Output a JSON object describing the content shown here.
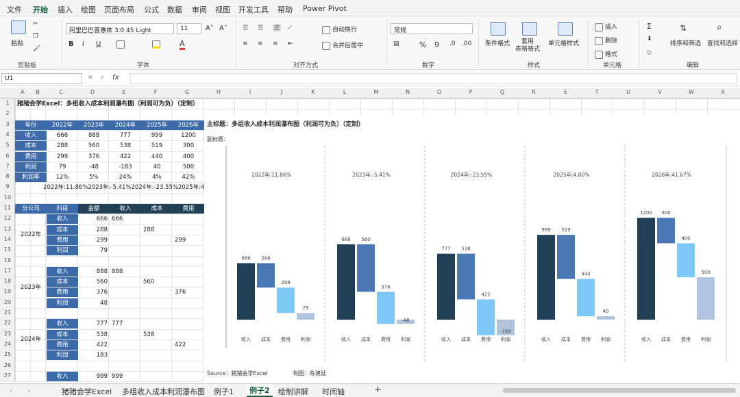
{
  "menu_tabs": [
    "文件",
    "开始",
    "插入",
    "绘图",
    "页面布局",
    "公式",
    "数据",
    "审阅",
    "视图",
    "开发工具",
    "帮助",
    "Power Pivot"
  ],
  "active_tab": "开始",
  "ribbon": {
    "paste": "粘贴",
    "clipboard_group": "剪贴板",
    "font_name": "阿里巴巴普惠体 3.0 45 Light",
    "font_size": "11",
    "font_group": "字体",
    "wrap_text": "自动换行",
    "merge_center": "合并后居中",
    "align_group": "对齐方式",
    "number_format": "常规",
    "number_group": "数字",
    "cond_format": "条件格式",
    "table_format": "套用\n表格格式",
    "cell_style": "单元格样式",
    "style_group": "样式",
    "insert": "插入",
    "delete": "删除",
    "format": "格式",
    "cells_group": "单元格",
    "sort_filter": "排序和筛选",
    "find_select": "查找和选择",
    "edit_group": "编辑"
  },
  "formula_bar": {
    "name_box": "U1",
    "fx": "fx",
    "formula": ""
  },
  "columns": [
    "A",
    "B",
    "C",
    "D",
    "E",
    "F",
    "G",
    "H",
    "I",
    "J",
    "K",
    "L",
    "M",
    "N",
    "O",
    "P",
    "Q",
    "R",
    "S",
    "T",
    "U",
    "V",
    "W",
    "X"
  ],
  "rows": [
    "1",
    "2",
    "3",
    "4",
    "5",
    "6",
    "7",
    "8",
    "9",
    "10",
    "11",
    "12",
    "13",
    "14",
    "15",
    "16",
    "17",
    "18",
    "19",
    "20",
    "21",
    "22",
    "23",
    "24",
    "25",
    "26",
    "27"
  ],
  "sheet_title": "猪猪会学Excel：多组收入成本利润瀑布图（利润可为负）（定制）",
  "table1": {
    "headers": [
      "年份",
      "2022年",
      "2023年",
      "2024年",
      "2025年",
      "2026年"
    ],
    "rows": [
      [
        "收入",
        "666",
        "888",
        "777",
        "999",
        "1200"
      ],
      [
        "成本",
        "288",
        "560",
        "538",
        "519",
        "300"
      ],
      [
        "费用",
        "299",
        "376",
        "422",
        "440",
        "400"
      ],
      [
        "利润",
        "79",
        "-48",
        "-183",
        "40",
        "500"
      ],
      [
        "利润率",
        "12%",
        "5%",
        "24%",
        "4%",
        "42%"
      ]
    ],
    "row9": "2022年:11.86%2023年:-5.41%2024年:-23.55%2025年:4.00%2026年:41.67"
  },
  "table2": {
    "headers": [
      "分公司",
      "科目",
      "金额",
      "收入",
      "成本",
      "费用"
    ],
    "groups": [
      {
        "year": "2022年",
        "rows": [
          [
            "收入",
            "666",
            "666",
            "",
            ""
          ],
          [
            "成本",
            "288",
            "",
            "288",
            ""
          ],
          [
            "费用",
            "299",
            "",
            "",
            "299"
          ],
          [
            "利润",
            "79",
            "",
            "",
            ""
          ]
        ]
      },
      {
        "year": "2023年",
        "rows": [
          [
            "收入",
            "888",
            "888",
            "",
            ""
          ],
          [
            "成本",
            "560",
            "",
            "560",
            ""
          ],
          [
            "费用",
            "376",
            "",
            "",
            "376"
          ],
          [
            "利润",
            "48",
            "",
            "",
            ""
          ]
        ]
      },
      {
        "year": "2024年",
        "rows": [
          [
            "收入",
            "777",
            "777",
            "",
            ""
          ],
          [
            "成本",
            "538",
            "",
            "538",
            ""
          ],
          [
            "费用",
            "422",
            "",
            "",
            "422"
          ],
          [
            "利润",
            "183",
            "",
            "",
            ""
          ]
        ]
      },
      {
        "year": "",
        "rows": [
          [
            "收入",
            "999",
            "999",
            "",
            ""
          ]
        ]
      }
    ]
  },
  "chart_data": {
    "type": "bar",
    "title": "主标题：多组收入成本利润瀑布图（利润可为负）（定制）",
    "subtitle": "副标题：",
    "categories": [
      "收入",
      "成本",
      "费用",
      "利润"
    ],
    "groups": [
      {
        "label": "2022年:11.86%",
        "values": [
          666,
          288,
          299,
          79
        ]
      },
      {
        "label": "2023年:-5.41%",
        "values": [
          888,
          560,
          376,
          -48
        ]
      },
      {
        "label": "2024年:-23.55%",
        "values": [
          777,
          538,
          422,
          -183
        ]
      },
      {
        "label": "2025年:4.00%",
        "values": [
          999,
          519,
          440,
          40
        ]
      },
      {
        "label": "2026年:41.67%",
        "values": [
          1200,
          300,
          400,
          500
        ]
      }
    ],
    "colors": {
      "income": "#213f55",
      "cost": "#4a78b5",
      "expense": "#7ec8f5",
      "profit": "#b0c4e0"
    },
    "ylim": [
      0,
      1300
    ],
    "grid": false,
    "source": "Source：猪猪会学Excel",
    "author": "制图：陈建廷"
  },
  "sheet_tabs": [
    "猪猪会学Excel",
    "多组收入成本利润瀑布图",
    "例子1",
    "例子2",
    "绘制讲解",
    "时间轴"
  ],
  "active_sheet": "例子2",
  "add_sheet": "+"
}
